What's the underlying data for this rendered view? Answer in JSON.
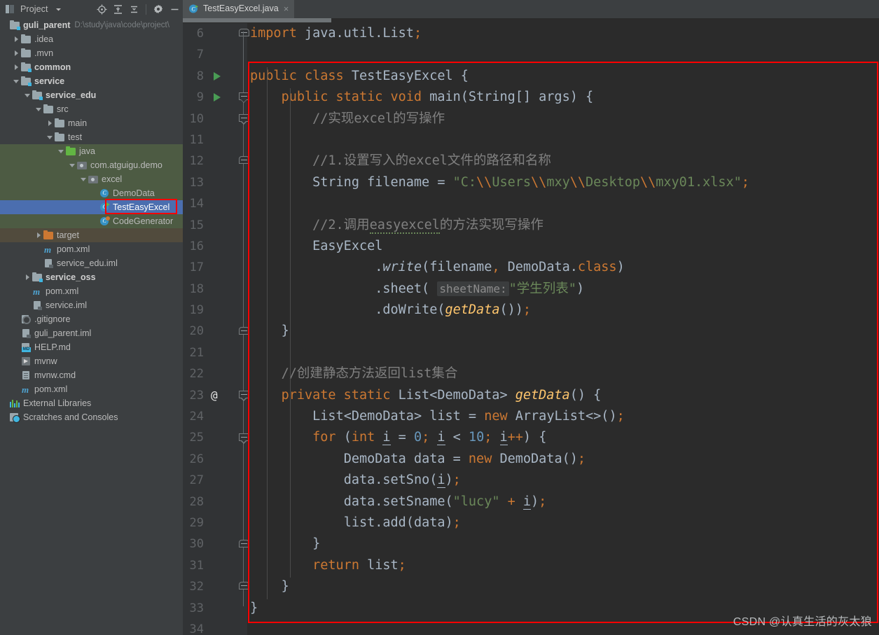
{
  "window": {
    "toolwindow_title": "Project",
    "toolwindow_icons": [
      "locate-icon",
      "expand-all-icon",
      "collapse-all-icon",
      "settings-gear-icon",
      "minimize-icon"
    ]
  },
  "tabs": [
    {
      "label": "TestEasyExcel.java",
      "icon": "java-class-runnable-icon",
      "close": "×",
      "active": true
    }
  ],
  "project_tree": {
    "root": {
      "label": "guli_parent",
      "path": "D:\\study\\java\\code\\project\\"
    },
    "items": [
      {
        "label": ".idea",
        "indent": 1,
        "arrow": "closed",
        "icon": "folder-icon",
        "state": "normal"
      },
      {
        "label": ".mvn",
        "indent": 1,
        "arrow": "closed",
        "icon": "folder-icon",
        "state": "normal"
      },
      {
        "label": "common",
        "indent": 1,
        "arrow": "closed",
        "icon": "module-folder-icon",
        "state": "module"
      },
      {
        "label": "service",
        "indent": 1,
        "arrow": "open",
        "icon": "module-folder-icon",
        "state": "module"
      },
      {
        "label": "service_edu",
        "indent": 2,
        "arrow": "open",
        "icon": "module-folder-icon",
        "state": "module"
      },
      {
        "label": "src",
        "indent": 3,
        "arrow": "open",
        "icon": "folder-icon",
        "state": "normal"
      },
      {
        "label": "main",
        "indent": 4,
        "arrow": "closed",
        "icon": "folder-icon",
        "state": "normal"
      },
      {
        "label": "test",
        "indent": 4,
        "arrow": "open",
        "icon": "folder-icon",
        "state": "normal"
      },
      {
        "label": "java",
        "indent": 5,
        "arrow": "open",
        "icon": "test-source-folder-icon",
        "state": "testsrc"
      },
      {
        "label": "com.atguigu.demo",
        "indent": 6,
        "arrow": "open",
        "icon": "package-icon",
        "state": "testsrc"
      },
      {
        "label": "excel",
        "indent": 7,
        "arrow": "open",
        "icon": "package-icon",
        "state": "testsrc"
      },
      {
        "label": "DemoData",
        "indent": 8,
        "arrow": "none",
        "icon": "java-class-icon",
        "state": "testsrc"
      },
      {
        "label": "TestEasyExcel",
        "indent": 8,
        "arrow": "none",
        "icon": "java-class-runnable-icon",
        "state": "selected"
      },
      {
        "label": "CodeGenerator",
        "indent": 8,
        "arrow": "none",
        "icon": "java-class-generator-icon",
        "state": "testsrc"
      },
      {
        "label": "target",
        "indent": 3,
        "arrow": "closed",
        "icon": "excluded-folder-icon",
        "state": "target"
      },
      {
        "label": "pom.xml",
        "indent": 3,
        "arrow": "none",
        "icon": "maven-icon",
        "state": "normal"
      },
      {
        "label": "service_edu.iml",
        "indent": 3,
        "arrow": "none",
        "icon": "iml-file-icon",
        "state": "normal"
      },
      {
        "label": "service_oss",
        "indent": 2,
        "arrow": "closed",
        "icon": "module-folder-icon",
        "state": "module"
      },
      {
        "label": "pom.xml",
        "indent": 2,
        "arrow": "none",
        "icon": "maven-icon",
        "state": "normal"
      },
      {
        "label": "service.iml",
        "indent": 2,
        "arrow": "none",
        "icon": "iml-file-icon",
        "state": "normal"
      },
      {
        "label": ".gitignore",
        "indent": 1,
        "arrow": "none",
        "icon": "gitignore-icon",
        "state": "normal"
      },
      {
        "label": "guli_parent.iml",
        "indent": 1,
        "arrow": "none",
        "icon": "iml-file-icon",
        "state": "normal"
      },
      {
        "label": "HELP.md",
        "indent": 1,
        "arrow": "none",
        "icon": "markdown-icon",
        "state": "normal"
      },
      {
        "label": "mvnw",
        "indent": 1,
        "arrow": "none",
        "icon": "script-icon",
        "state": "normal"
      },
      {
        "label": "mvnw.cmd",
        "indent": 1,
        "arrow": "none",
        "icon": "cmd-file-icon",
        "state": "normal"
      },
      {
        "label": "pom.xml",
        "indent": 1,
        "arrow": "none",
        "icon": "maven-icon",
        "state": "normal"
      },
      {
        "label": "External Libraries",
        "indent": 0,
        "arrow": "none",
        "icon": "external-libraries-icon",
        "state": "normal"
      },
      {
        "label": "Scratches and Consoles",
        "indent": 0,
        "arrow": "none",
        "icon": "scratches-icon",
        "state": "normal"
      }
    ]
  },
  "editor": {
    "first_line": 6,
    "last_line": 34,
    "run_gutter_lines": [
      8,
      9
    ],
    "annotation_lines": [
      23
    ],
    "lines": [
      {
        "n": 6,
        "text": "import java.util.List;"
      },
      {
        "n": 7,
        "text": ""
      },
      {
        "n": 8,
        "text": "public class TestEasyExcel {"
      },
      {
        "n": 9,
        "text": "    public static void main(String[] args) {"
      },
      {
        "n": 10,
        "text": "        //实现excel的写操作"
      },
      {
        "n": 11,
        "text": ""
      },
      {
        "n": 12,
        "text": "        //1.设置写入的excel文件的路径和名称"
      },
      {
        "n": 13,
        "text": "        String filename = \"C:\\\\Users\\\\mxy\\\\Desktop\\\\mxy01.xlsx\";"
      },
      {
        "n": 14,
        "text": ""
      },
      {
        "n": 15,
        "text": "        //2.调用easyexcel的方法实现写操作"
      },
      {
        "n": 16,
        "text": "        EasyExcel"
      },
      {
        "n": 17,
        "text": "                .write(filename, DemoData.class)"
      },
      {
        "n": 18,
        "text": "                .sheet( sheetName: \"学生列表\")"
      },
      {
        "n": 19,
        "text": "                .doWrite(getData());"
      },
      {
        "n": 20,
        "text": "    }"
      },
      {
        "n": 21,
        "text": ""
      },
      {
        "n": 22,
        "text": "    //创建静态方法返回list集合"
      },
      {
        "n": 23,
        "text": "    private static List<DemoData> getData() {"
      },
      {
        "n": 24,
        "text": "        List<DemoData> list = new ArrayList<>();"
      },
      {
        "n": 25,
        "text": "        for (int i = 0; i < 10; i++) {"
      },
      {
        "n": 26,
        "text": "            DemoData data = new DemoData();"
      },
      {
        "n": 27,
        "text": "            data.setSno(i);"
      },
      {
        "n": 28,
        "text": "            data.setSname(\"lucy\" + i);"
      },
      {
        "n": 29,
        "text": "            list.add(data);"
      },
      {
        "n": 30,
        "text": "        }"
      },
      {
        "n": 31,
        "text": "        return list;"
      },
      {
        "n": 32,
        "text": "    }"
      },
      {
        "n": 33,
        "text": "}"
      },
      {
        "n": 34,
        "text": ""
      }
    ],
    "parameter_hint": "sheetName:"
  },
  "watermark": {
    "text": "CSDN @认真生活的灰太狼"
  },
  "colors": {
    "editor_bg": "#2b2b2b",
    "gutter_bg": "#313335",
    "panel_bg": "#3c3f41",
    "selection_blue": "#4b6eaf",
    "test_source_green": "#4d5b43",
    "excluded_brown": "#514b3d",
    "keyword_orange": "#cc7832",
    "string_green": "#6a8759",
    "method_yellow": "#ffc66d",
    "number_blue": "#6897bb",
    "comment_gray": "#808080",
    "identifier": "#a9b7c6",
    "annotation_red": "#ff0000",
    "run_green": "#499c54"
  }
}
